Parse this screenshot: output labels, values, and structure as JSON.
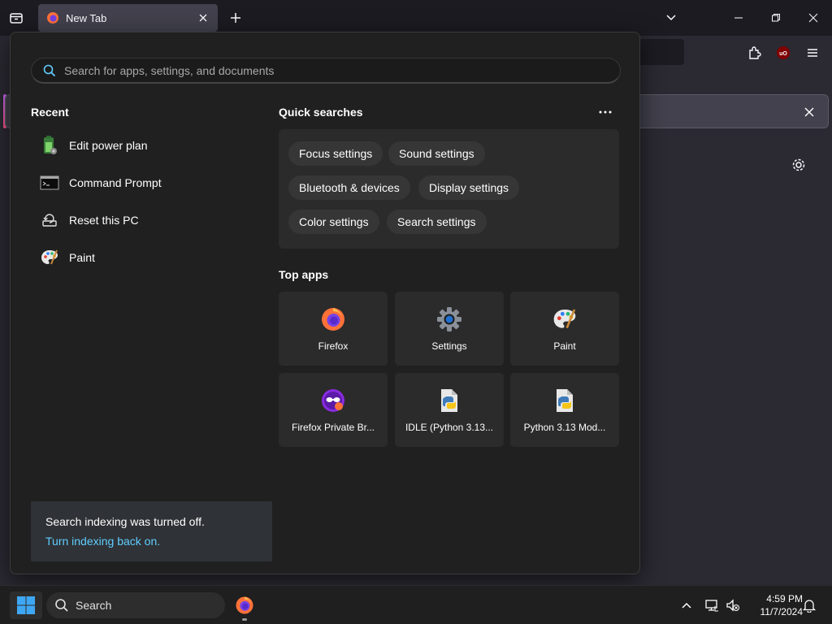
{
  "browser": {
    "tab_title": "New Tab"
  },
  "start_search": {
    "search_placeholder": "Search for apps, settings, and documents",
    "recent_title": "Recent",
    "recent_items": [
      {
        "label": "Edit power plan",
        "icon": "battery-settings-icon"
      },
      {
        "label": "Command Prompt",
        "icon": "terminal-icon"
      },
      {
        "label": "Reset this PC",
        "icon": "reset-pc-icon"
      },
      {
        "label": "Paint",
        "icon": "palette-icon"
      }
    ],
    "quick_searches_title": "Quick searches",
    "quick_searches": [
      "Focus settings",
      "Sound settings",
      "Bluetooth & devices",
      "Display settings",
      "Color settings",
      "Search settings"
    ],
    "top_apps_title": "Top apps",
    "top_apps": [
      {
        "label": "Firefox",
        "icon": "firefox-icon"
      },
      {
        "label": "Settings",
        "icon": "gear-icon"
      },
      {
        "label": "Paint",
        "icon": "palette-icon"
      },
      {
        "label": "Firefox Private Br...",
        "icon": "firefox-private-icon"
      },
      {
        "label": "IDLE (Python 3.13...",
        "icon": "python-file-icon"
      },
      {
        "label": "Python 3.13 Mod...",
        "icon": "python-file-icon"
      }
    ],
    "index_notice": {
      "message": "Search indexing was turned off.",
      "link": "Turn indexing back on."
    }
  },
  "taskbar": {
    "search_label": "Search",
    "time": "4:59 PM",
    "date": "11/7/2024"
  },
  "colors": {
    "accent_link": "#60cdff",
    "panel_bg": "#202020",
    "tile_bg": "#2b2b2b",
    "chip_bg": "#363636",
    "windows_blue": "#3ea7f3"
  }
}
